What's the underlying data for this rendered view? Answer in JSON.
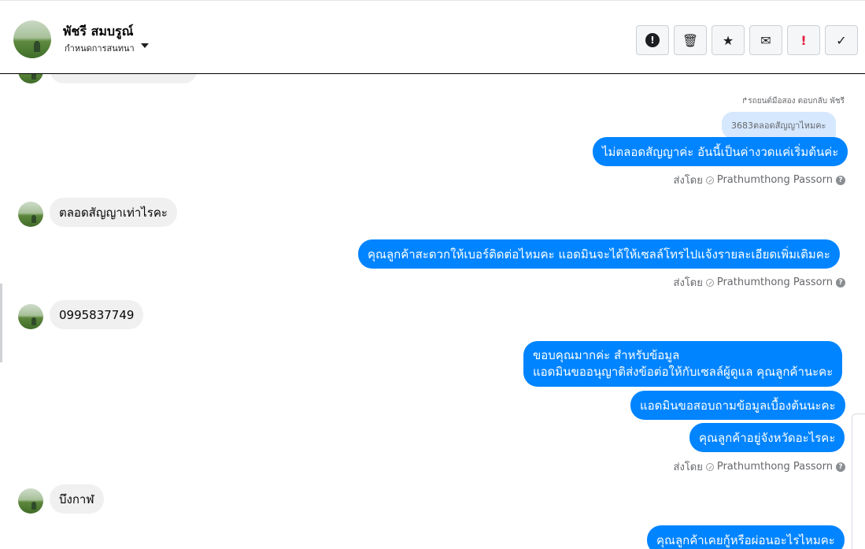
{
  "header": {
    "name": "พัชรี สมบรูณ์",
    "subtitle": "กำหนดการสนทนา",
    "toolbar": {
      "spam_icon": "!",
      "trash_icon": "🗑",
      "star_icon": "★",
      "mail_icon": "✉",
      "important_icon": "!",
      "done_icon": "✓"
    }
  },
  "conversation": {
    "reply_note": "↱รถยนต์มือสอง ตอบกลับ พัชรี",
    "quoted_message": "3683ตลอดสัญญาไหมคะ",
    "messages": [
      {
        "direction": "out",
        "text": "ไม่ตลอดสัญญาค่ะ อันนี้เป็นค่างวดแค่เริ่มต้นค่ะ"
      },
      {
        "direction": "in",
        "text": "ตลอดสัญญาเท่าไรคะ"
      },
      {
        "direction": "out",
        "text": "คุณลูกค้าสะดวกให้เบอร์ติดต่อไหมคะ  แอดมินจะได้ให้เซลล์โทรไปแจ้งรายละเอียดเพิ่มเติมคะ"
      },
      {
        "direction": "in",
        "text": "0995837749"
      },
      {
        "direction": "out",
        "line1": "ขอบคุณมากค่ะ สำหรับข้อมูล",
        "line2": "แอดมินขออนุญาติส่งข้อต่อให้กับเซลล์ผู้ดูแล คุณลูกค้านะคะ"
      },
      {
        "direction": "out",
        "text": "แอดมินขอสอบถามข้อมูลเบื้องต้นนะคะ"
      },
      {
        "direction": "out",
        "text": "คุณลูกค้าอยู่จังหวัดอะไรคะ"
      },
      {
        "direction": "in",
        "text": "บึงกาฬ"
      },
      {
        "direction": "out",
        "text": "คุณลูกค้าเคยกู้หรือผ่อนอะไรไหมคะ"
      }
    ],
    "sent_by_prefix": "ส่งโดย",
    "sent_by_name": "Prathumthong Passorn",
    "help_icon": "?"
  }
}
